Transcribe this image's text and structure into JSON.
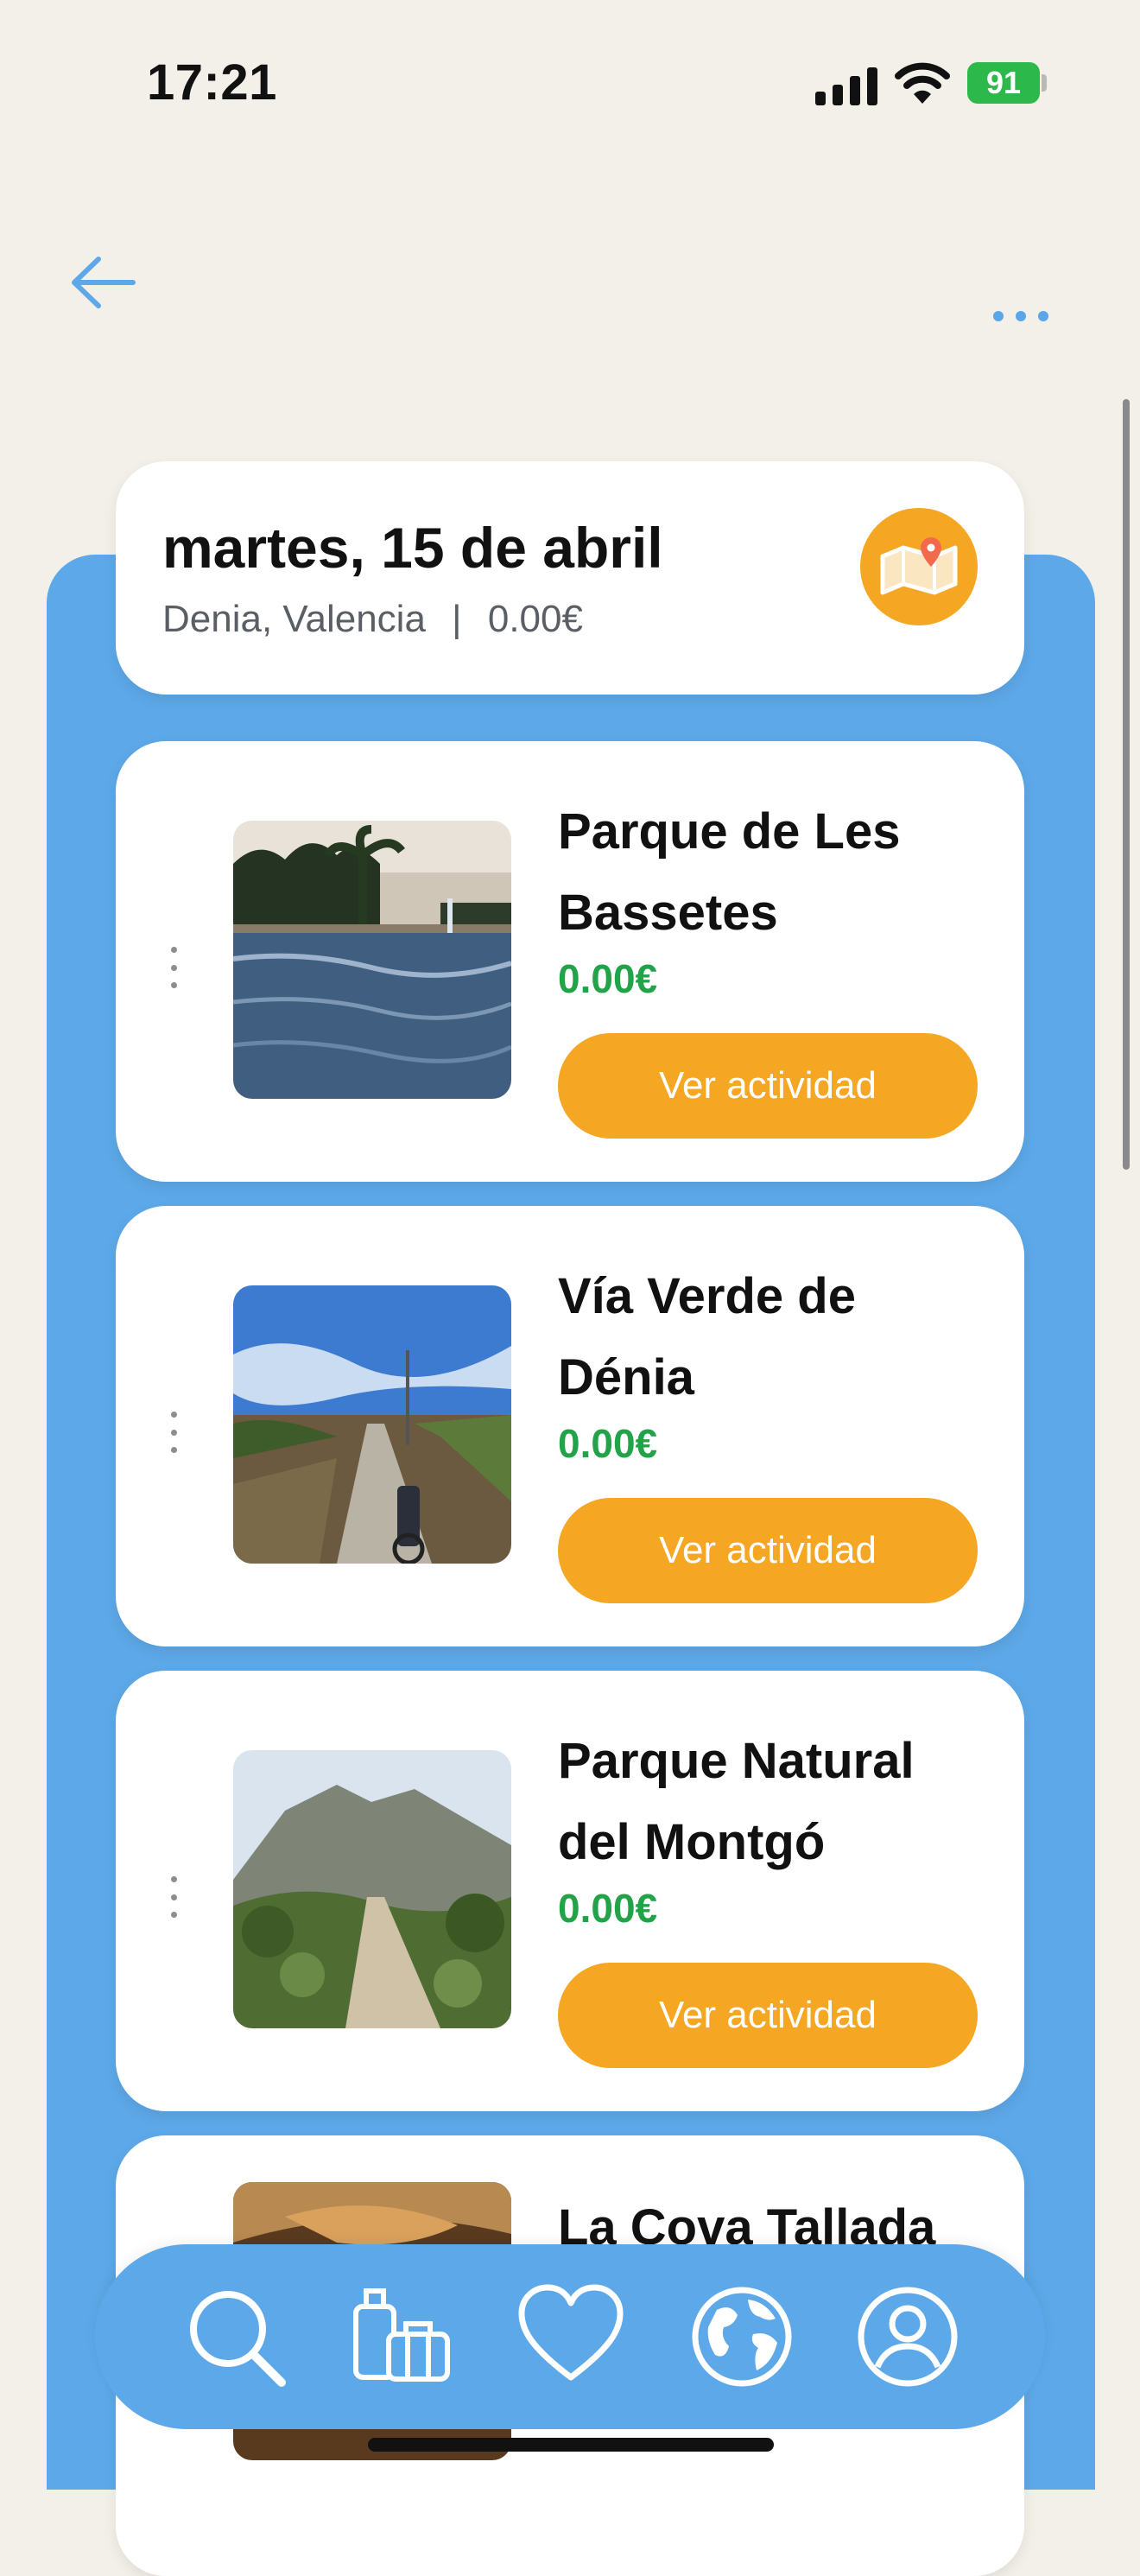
{
  "status": {
    "time": "17:21",
    "battery": "91"
  },
  "day": {
    "title": "martes, 15 de abril",
    "location": "Denia, Valencia",
    "separator": "|",
    "total": "0.00€"
  },
  "activities": [
    {
      "name": "Parque de Les Bassetes",
      "price": "0.00€",
      "button": "Ver actividad",
      "image": "fountain-pond"
    },
    {
      "name": "Vía Verde de Dénia",
      "price": "0.00€",
      "button": "Ver actividad",
      "image": "bike-path"
    },
    {
      "name": "Parque Natural del Montgó",
      "price": "0.00€",
      "button": "Ver actividad",
      "image": "mountain-trail"
    },
    {
      "name": "La Cova Tallada",
      "price": "",
      "button": "",
      "image": "cave"
    }
  ],
  "bottom_nav": [
    "search-icon",
    "luggage-icon",
    "heart-icon",
    "globe-icon",
    "profile-icon"
  ],
  "colors": {
    "accent": "#F5A623",
    "panel": "#5DA8E8",
    "price": "#23A349",
    "background": "#F3EFE9"
  }
}
